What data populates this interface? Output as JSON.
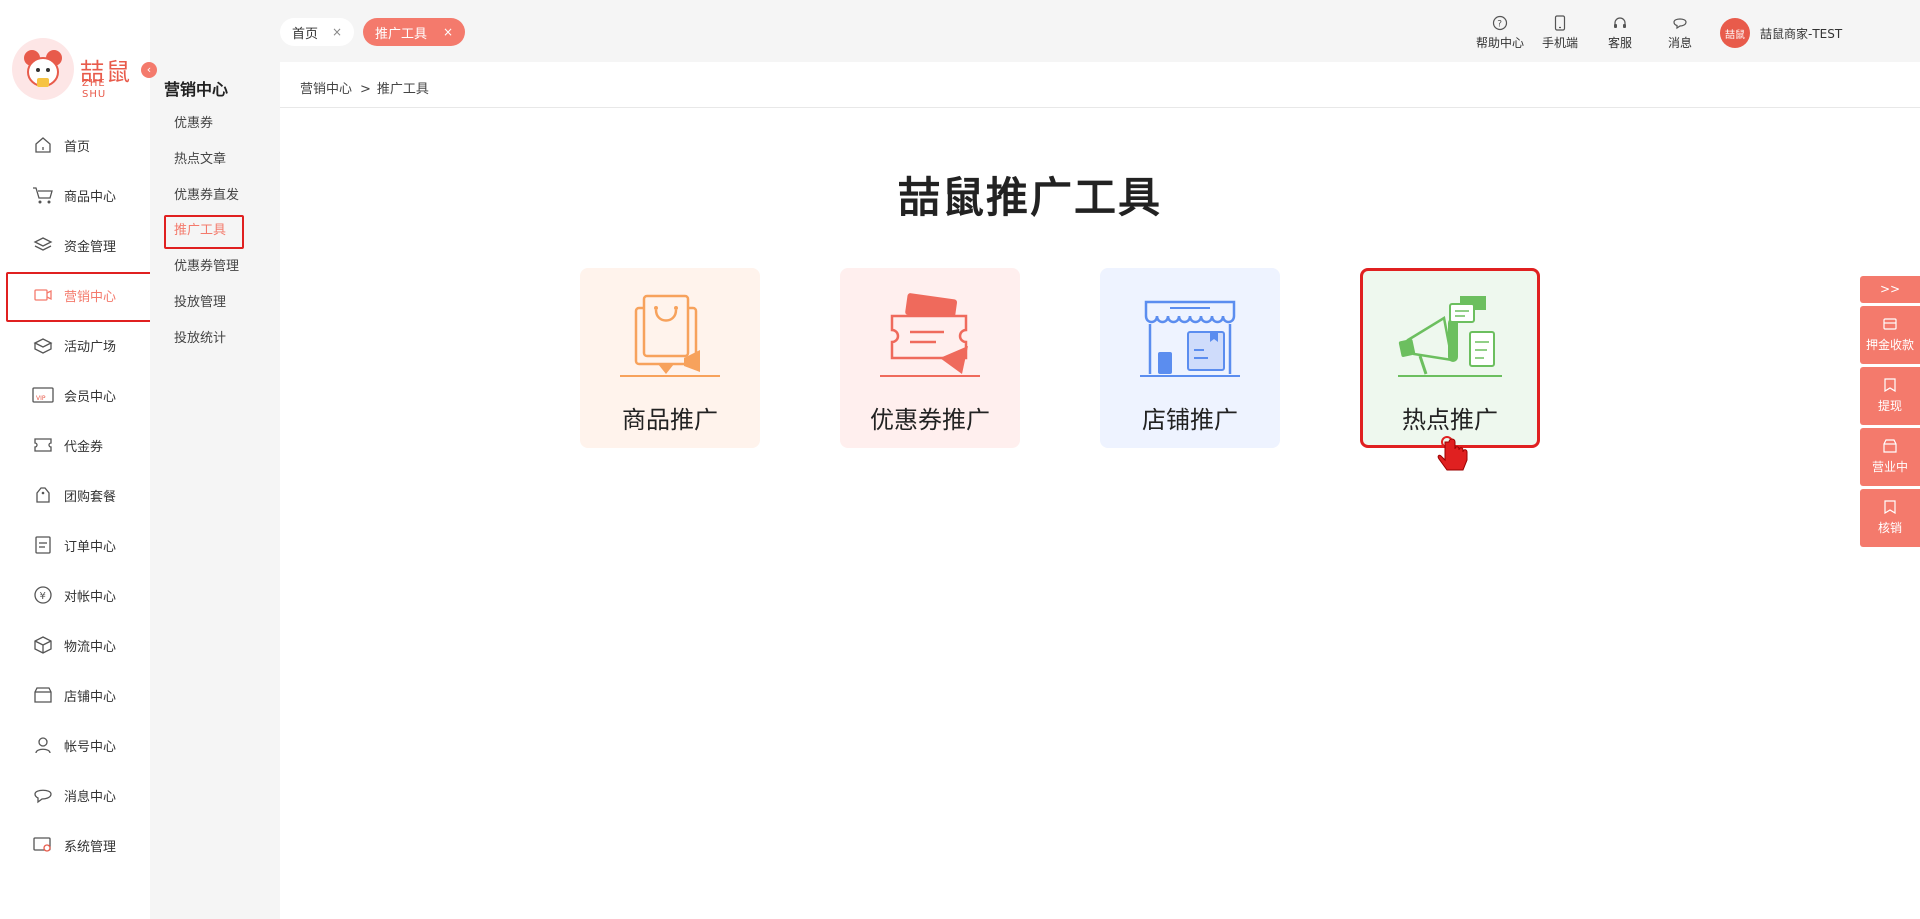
{
  "logo": {
    "text": "喆鼠",
    "sub": "ZHE SHU"
  },
  "sidebar": {
    "collapse": "‹",
    "items": [
      {
        "label": "首页",
        "icon": "home-icon"
      },
      {
        "label": "商品中心",
        "icon": "cart-icon"
      },
      {
        "label": "资金管理",
        "icon": "layers-icon"
      },
      {
        "label": "营销中心",
        "icon": "marketing-icon",
        "active": true
      },
      {
        "label": "活动广场",
        "icon": "box-icon"
      },
      {
        "label": "会员中心",
        "icon": "vip-icon"
      },
      {
        "label": "代金券",
        "icon": "voucher-icon"
      },
      {
        "label": "团购套餐",
        "icon": "tag-icon"
      },
      {
        "label": "订单中心",
        "icon": "order-icon"
      },
      {
        "label": "对帐中心",
        "icon": "yen-icon"
      },
      {
        "label": "物流中心",
        "icon": "package-icon"
      },
      {
        "label": "店铺中心",
        "icon": "store-icon"
      },
      {
        "label": "帐号中心",
        "icon": "user-icon"
      },
      {
        "label": "消息中心",
        "icon": "message-icon"
      },
      {
        "label": "系统管理",
        "icon": "settings-icon"
      }
    ]
  },
  "subnav": {
    "title": "营销中心",
    "items": [
      {
        "label": "优惠券"
      },
      {
        "label": "热点文章"
      },
      {
        "label": "优惠券直发"
      },
      {
        "label": "推广工具",
        "active": true
      },
      {
        "label": "优惠券管理"
      },
      {
        "label": "投放管理"
      },
      {
        "label": "投放统计"
      }
    ]
  },
  "tabs": [
    {
      "label": "首页",
      "close": "×"
    },
    {
      "label": "推广工具",
      "close": "×"
    }
  ],
  "top_actions": [
    {
      "label": "帮助中心",
      "icon": "help-icon"
    },
    {
      "label": "手机端",
      "icon": "phone-icon"
    },
    {
      "label": "客服",
      "icon": "headset-icon"
    },
    {
      "label": "消息",
      "icon": "chat-icon"
    }
  ],
  "user": {
    "avatar_text": "喆鼠",
    "name": "喆鼠商家-TEST"
  },
  "breadcrumb": {
    "parent": "营销中心",
    "sep": ">",
    "current": "推广工具"
  },
  "page_title": "喆鼠推广工具",
  "cards": [
    {
      "label": "商品推广",
      "color": "#f7a25c"
    },
    {
      "label": "优惠券推广",
      "color": "#ef6a5c"
    },
    {
      "label": "店铺推广",
      "color": "#5b8def"
    },
    {
      "label": "热点推广",
      "color": "#6cbf5f"
    }
  ],
  "float_panel": {
    "toggle": ">>",
    "items": [
      {
        "label": "押金收款",
        "icon": "wallet-icon"
      },
      {
        "label": "提现",
        "icon": "withdraw-icon"
      },
      {
        "label": "营业中",
        "icon": "shop-open-icon"
      },
      {
        "label": "核销",
        "icon": "verify-icon"
      }
    ]
  },
  "colors": {
    "accent": "#f47a6c",
    "highlight": "#e02020"
  }
}
